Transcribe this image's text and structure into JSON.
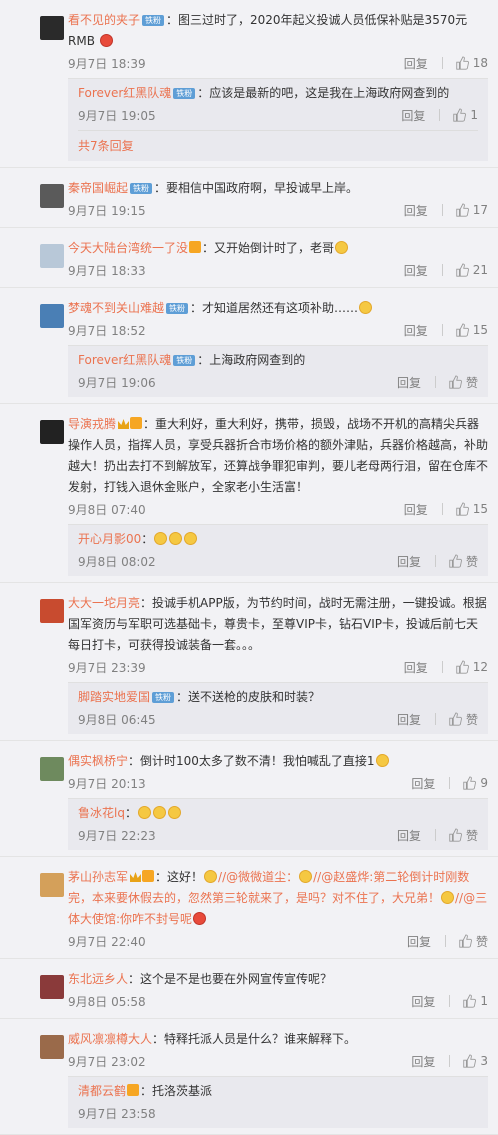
{
  "comments": [
    {
      "name": "看不见的夹子",
      "badge": "铁粉",
      "text": "：图三过时了，2020年起义投诚人员低保补贴是3570元RMB",
      "time": "9月7日 18:39",
      "reply": "回复",
      "likes": "18",
      "avatar_color": "#2a2a2a",
      "sub": [
        {
          "name": "Forever红黑队魂",
          "badge": "铁粉",
          "text": "：应该是最新的吧，这是我在上海政府网查到的",
          "time": "9月7日 19:05",
          "reply": "回复",
          "likes": "1"
        }
      ],
      "more": "共7条回复"
    },
    {
      "name": "秦帝国崛起",
      "badge": "铁粉",
      "text": "：要相信中国政府啊，早投诚早上岸。",
      "time": "9月7日 19:15",
      "reply": "回复",
      "likes": "17",
      "avatar_color": "#5a5a5a"
    },
    {
      "name": "今天大陆台湾统一了没",
      "text": "：又开始倒计时了，老哥",
      "time": "9月7日 18:33",
      "reply": "回复",
      "likes": "21",
      "avatar_color": "#b8c8d8"
    },
    {
      "name": "梦魂不到关山难越",
      "badge": "铁粉",
      "text": "：才知道居然还有这项补助……",
      "time": "9月7日 18:52",
      "reply": "回复",
      "likes": "15",
      "avatar_color": "#4a7fb5",
      "sub": [
        {
          "name": "Forever红黑队魂",
          "badge": "铁粉",
          "text": "：上海政府网查到的",
          "time": "9月7日 19:06",
          "reply": "回复",
          "likes": "赞"
        }
      ]
    },
    {
      "name": "导演戎腾",
      "text": "：重大利好，重大利好，携带，损毁，战场不开机的高精尖兵器操作人员，指挥人员，享受兵器折合市场价格的额外津贴，兵器价格越高，补助越大！扔出去打不到解放军，还算战争罪犯审判，要儿老母两行泪，留在仓库不发射，打钱入退休金账户，全家老小生活富！",
      "time": "9月8日 07:40",
      "reply": "回复",
      "likes": "15",
      "avatar_color": "#222222",
      "sub": [
        {
          "name": "开心月影00",
          "badge": "",
          "text": "：",
          "time": "9月8日 08:02",
          "reply": "回复",
          "likes": "赞",
          "emojis": 3
        }
      ]
    },
    {
      "name": "大大一坨月亮",
      "text": "：投诚手机APP版，为节约时间，战时无需注册，一键投诚。根据国军资历与军职可选基础卡，尊贵卡，至尊VIP卡，钻石VIP卡，投诚后前七天每日打卡，可获得投诚装备一套。。。",
      "time": "9月7日 23:39",
      "reply": "回复",
      "likes": "12",
      "avatar_color": "#c84b2f",
      "sub": [
        {
          "name": "脚踏实地爱国",
          "badge": "铁粉",
          "text": "：送不送枪的皮肤和时装？",
          "time": "9月8日 06:45",
          "reply": "回复",
          "likes": "赞"
        }
      ]
    },
    {
      "name": "偶实枫桥宁",
      "text": "：倒计时100太多了数不清！我怕喊乱了直接1",
      "time": "9月7日 20:13",
      "reply": "回复",
      "likes": "9",
      "avatar_color": "#6e8a5e",
      "sub": [
        {
          "name": "鲁冰花lq",
          "badge": "",
          "text": "：",
          "time": "9月7日 22:23",
          "reply": "回复",
          "likes": "赞",
          "emojis": 3
        }
      ]
    },
    {
      "name": "茅山孙志军",
      "text": "：这好！",
      "text2": "//@微微道尘：",
      "text3": "//@赵盛烨:第二轮倒计时刚数完，本来要休假去的，忽然第三轮就来了，是吗？对不住了，大兄弟！",
      "text4": "//@三体大使馆:你咋不封号呢",
      "time": "9月7日 22:40",
      "reply": "回复",
      "likes": "赞",
      "avatar_color": "#d4a05a"
    },
    {
      "name": "东北远乡人",
      "text": "：这个是不是也要在外网宣传宣传呢？",
      "time": "9月8日 05:58",
      "reply": "回复",
      "likes": "1",
      "avatar_color": "#8a3a3a"
    },
    {
      "name": "威风凛凛樽大人",
      "text": "：特释托派人员是什么？谁来解释下。",
      "time": "9月7日 23:02",
      "reply": "回复",
      "likes": "3",
      "avatar_color": "#9a6a4a",
      "sub": [
        {
          "name": "清都云鹤",
          "badge": "",
          "text": "：托洛茨基派",
          "time": "9月7日 23:58",
          "reply": "",
          "likes": ""
        }
      ]
    }
  ]
}
